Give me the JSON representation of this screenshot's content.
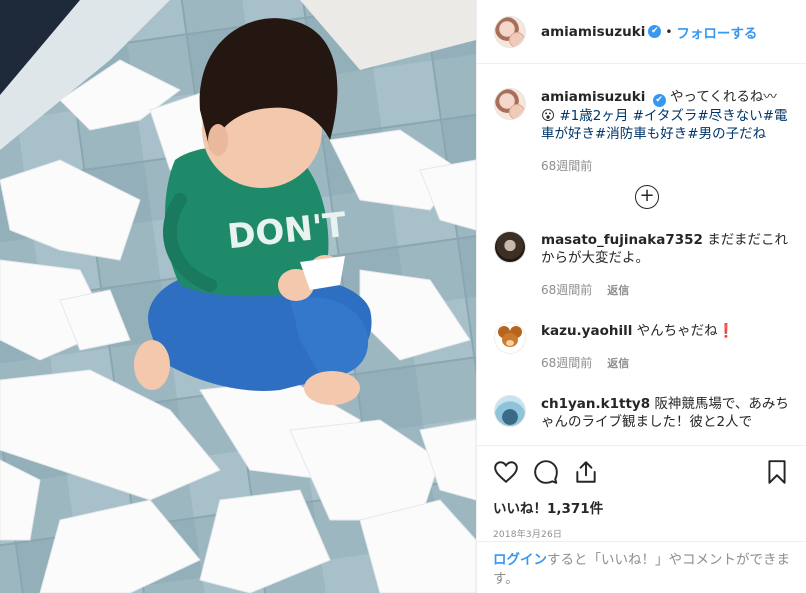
{
  "header": {
    "username": "amiamisuzuki",
    "verified_mark": "✔",
    "separator": "•",
    "follow_label": "フォローする"
  },
  "caption": {
    "username": "amiamisuzuki",
    "text": "やってくれるね〰😮",
    "hashtags": "#1歳2ヶ月 #イタズラ#尽きない#電車が好き#消防車も好き#男の子だね",
    "time": "68週間前"
  },
  "load_more_icon": "plus-circle",
  "comments": [
    {
      "username": "masato_fujinaka7352",
      "text": "まだまだこれからが大変だよ。",
      "time": "68週間前",
      "reply_label": "返信"
    },
    {
      "username": "kazu.yaohill",
      "text": "やんちゃだね❗",
      "time": "68週間前",
      "reply_label": "返信"
    },
    {
      "username": "ch1yan.k1tty8",
      "text": "阪神競馬場で、あみちゃんのライブ観ました！彼と2人で",
      "time": "",
      "reply_label": ""
    }
  ],
  "actions": {
    "likes": "いいね！1,371件",
    "date": "2018年3月26日"
  },
  "login_bar": {
    "link": "ログイン",
    "text": "すると「いいね！」やコメントができます。"
  },
  "colors": {
    "accent": "#3897f0",
    "hashtag": "#003569",
    "muted": "#8e8e8e",
    "floor": "#9fb8c2",
    "shirt": "#1f8a6a",
    "pants": "#2f6fc1"
  }
}
